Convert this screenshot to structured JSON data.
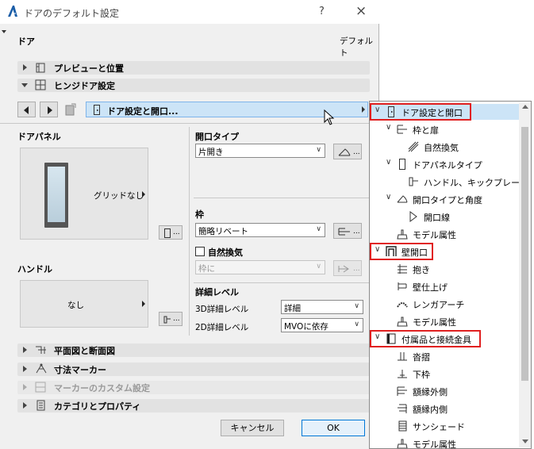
{
  "window": {
    "title": "ドアのデフォルト設定",
    "help_label": "?",
    "close_label": "×"
  },
  "header": {
    "left_label": "ドア",
    "right_label": "デフォルト"
  },
  "sections": {
    "preview": "プレビューと位置",
    "hinge": "ヒンジドア設定",
    "plan": "平面図と断面図",
    "dim": "寸法マーカー",
    "marker": "マーカーのカスタム設定",
    "category": "カテゴリとプロパティ"
  },
  "nav": {
    "page_label": "ドア設定と開口..."
  },
  "door_panel": {
    "title": "ドアパネル",
    "grid_label": "グリッドなし"
  },
  "handle": {
    "title": "ハンドル",
    "value": "なし"
  },
  "opening_type": {
    "title": "開口タイプ",
    "value": "片開き"
  },
  "frame": {
    "title": "枠",
    "value": "簡略リベート",
    "natural_vent_label": "自然換気",
    "sub_value": "枠に"
  },
  "detail": {
    "title": "詳細レベル",
    "label_3d": "3D詳細レベル",
    "value_3d": "詳細",
    "label_2d": "2D詳細レベル",
    "value_2d": "MVOに依存"
  },
  "buttons": {
    "cancel": "キャンセル",
    "ok": "OK"
  },
  "tree": [
    {
      "label": "ドア設定と開口",
      "level": 0,
      "expanded": true,
      "highlight": true,
      "icon": "door-icon"
    },
    {
      "label": "枠と扉",
      "level": 1,
      "expanded": true,
      "icon": "frame-icon"
    },
    {
      "label": "自然換気",
      "level": 2,
      "icon": "vent-icon"
    },
    {
      "label": "ドアパネルタイプ",
      "level": 1,
      "expanded": true,
      "icon": "panel-icon"
    },
    {
      "label": "ハンドル、キックプレート",
      "level": 2,
      "icon": "handle-icon"
    },
    {
      "label": "開口タイプと角度",
      "level": 1,
      "expanded": true,
      "icon": "angle-icon"
    },
    {
      "label": "開口線",
      "level": 2,
      "icon": "openline-icon"
    },
    {
      "label": "モデル属性",
      "level": 1,
      "icon": "brush-icon"
    },
    {
      "label": "壁開口",
      "level": 0,
      "expanded": true,
      "highlight": true,
      "icon": "wall-opening-icon"
    },
    {
      "label": "抱き",
      "level": 1,
      "icon": "reveal-icon"
    },
    {
      "label": "壁仕上げ",
      "level": 1,
      "icon": "wall-finish-icon"
    },
    {
      "label": "レンガアーチ",
      "level": 1,
      "icon": "arch-icon"
    },
    {
      "label": "モデル属性",
      "level": 1,
      "icon": "brush-icon"
    },
    {
      "label": "付属品と接続金具",
      "level": 0,
      "expanded": true,
      "highlight": true,
      "icon": "book-icon"
    },
    {
      "label": "沓摺",
      "level": 1,
      "icon": "threshold-icon"
    },
    {
      "label": "下枠",
      "level": 1,
      "icon": "sill-icon"
    },
    {
      "label": "額縁外側",
      "level": 1,
      "icon": "casing-out-icon"
    },
    {
      "label": "額縁内側",
      "level": 1,
      "icon": "casing-in-icon"
    },
    {
      "label": "サンシェード",
      "level": 1,
      "icon": "sunshade-icon"
    },
    {
      "label": "モデル属性",
      "level": 1,
      "icon": "brush-icon"
    }
  ]
}
